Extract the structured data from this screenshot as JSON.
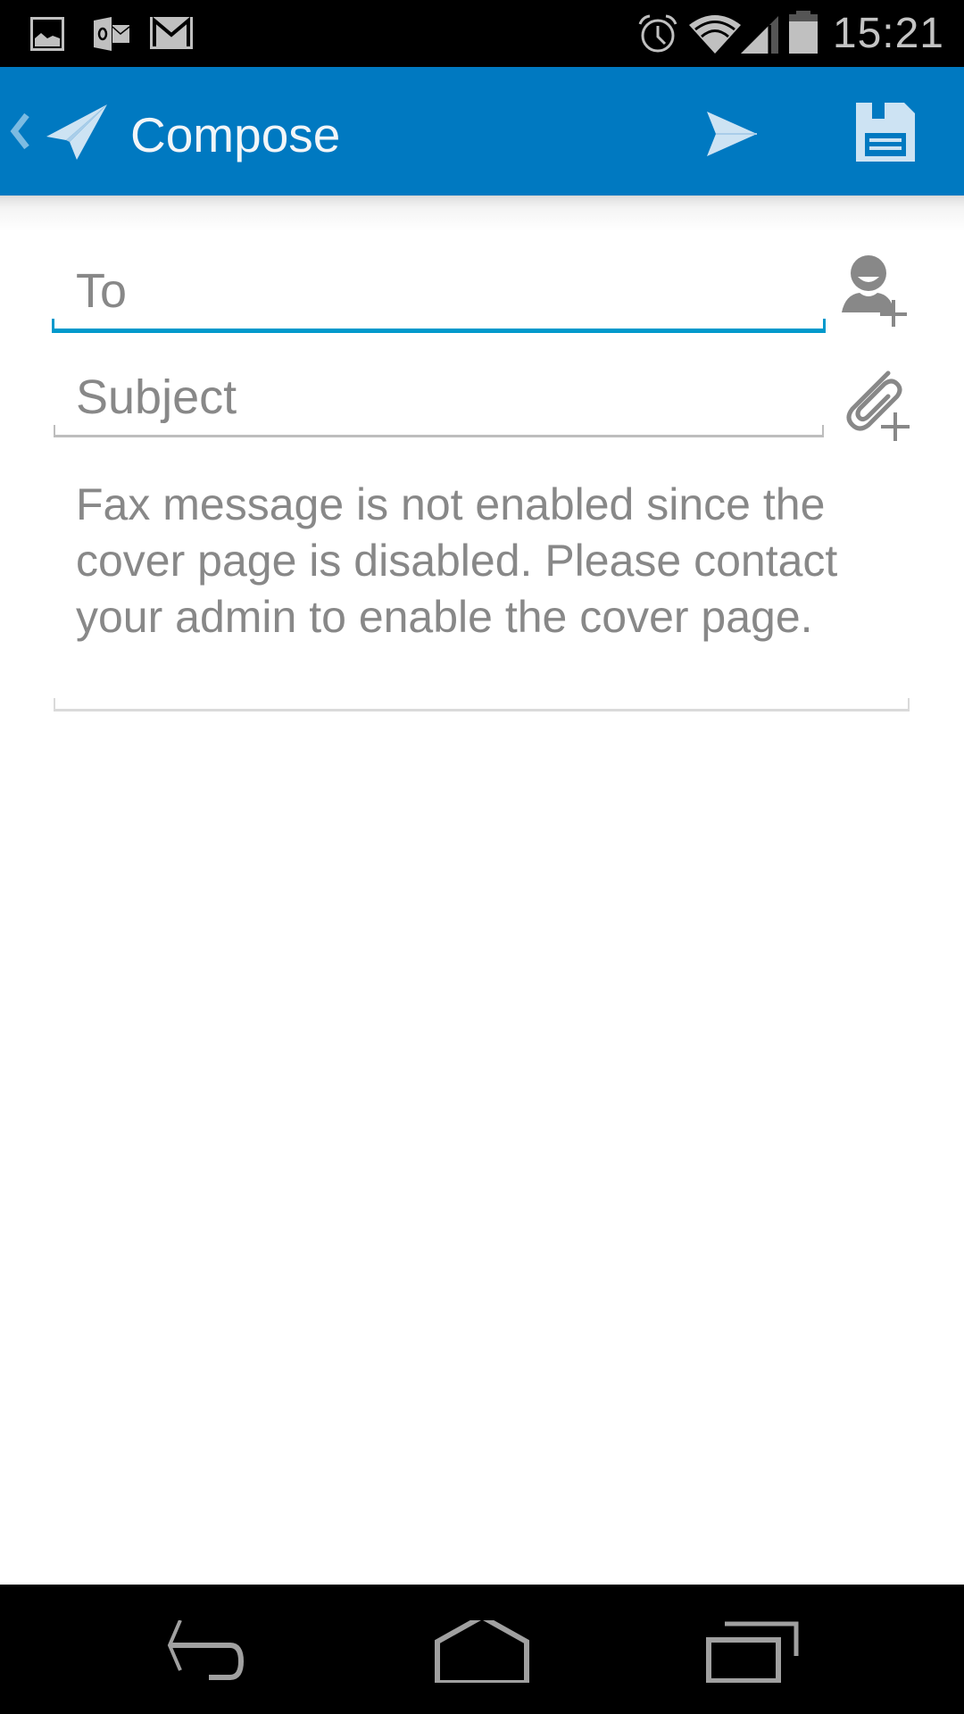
{
  "status_bar": {
    "notification_icons": [
      "gallery-icon",
      "outlook-icon",
      "gmail-icon"
    ],
    "system_icons": [
      "alarm-icon",
      "wifi-icon",
      "cellular-signal-icon",
      "battery-icon"
    ],
    "time": "15:21"
  },
  "app_bar": {
    "title": "Compose",
    "up_icon": "chevron-left-icon",
    "logo_icon": "paper-plane-icon",
    "actions": [
      {
        "name": "send",
        "icon": "send-icon"
      },
      {
        "name": "save",
        "icon": "floppy-disk-icon"
      }
    ]
  },
  "form": {
    "to": {
      "placeholder": "To",
      "value": ""
    },
    "subject": {
      "placeholder": "Subject",
      "value": ""
    },
    "body": {
      "message": "Fax message is not enabled since the cover page is disabled. Please contact your admin to enable the cover page."
    },
    "add_contact_icon": "add-contact-icon",
    "attach_icon": "attach-file-icon"
  },
  "nav_bar": {
    "buttons": [
      "back",
      "home",
      "recent-apps"
    ]
  },
  "colors": {
    "app_bar": "#0079c1",
    "focus_underline": "#0099cc",
    "hint_text": "#888888",
    "icon_gray": "#888888"
  }
}
